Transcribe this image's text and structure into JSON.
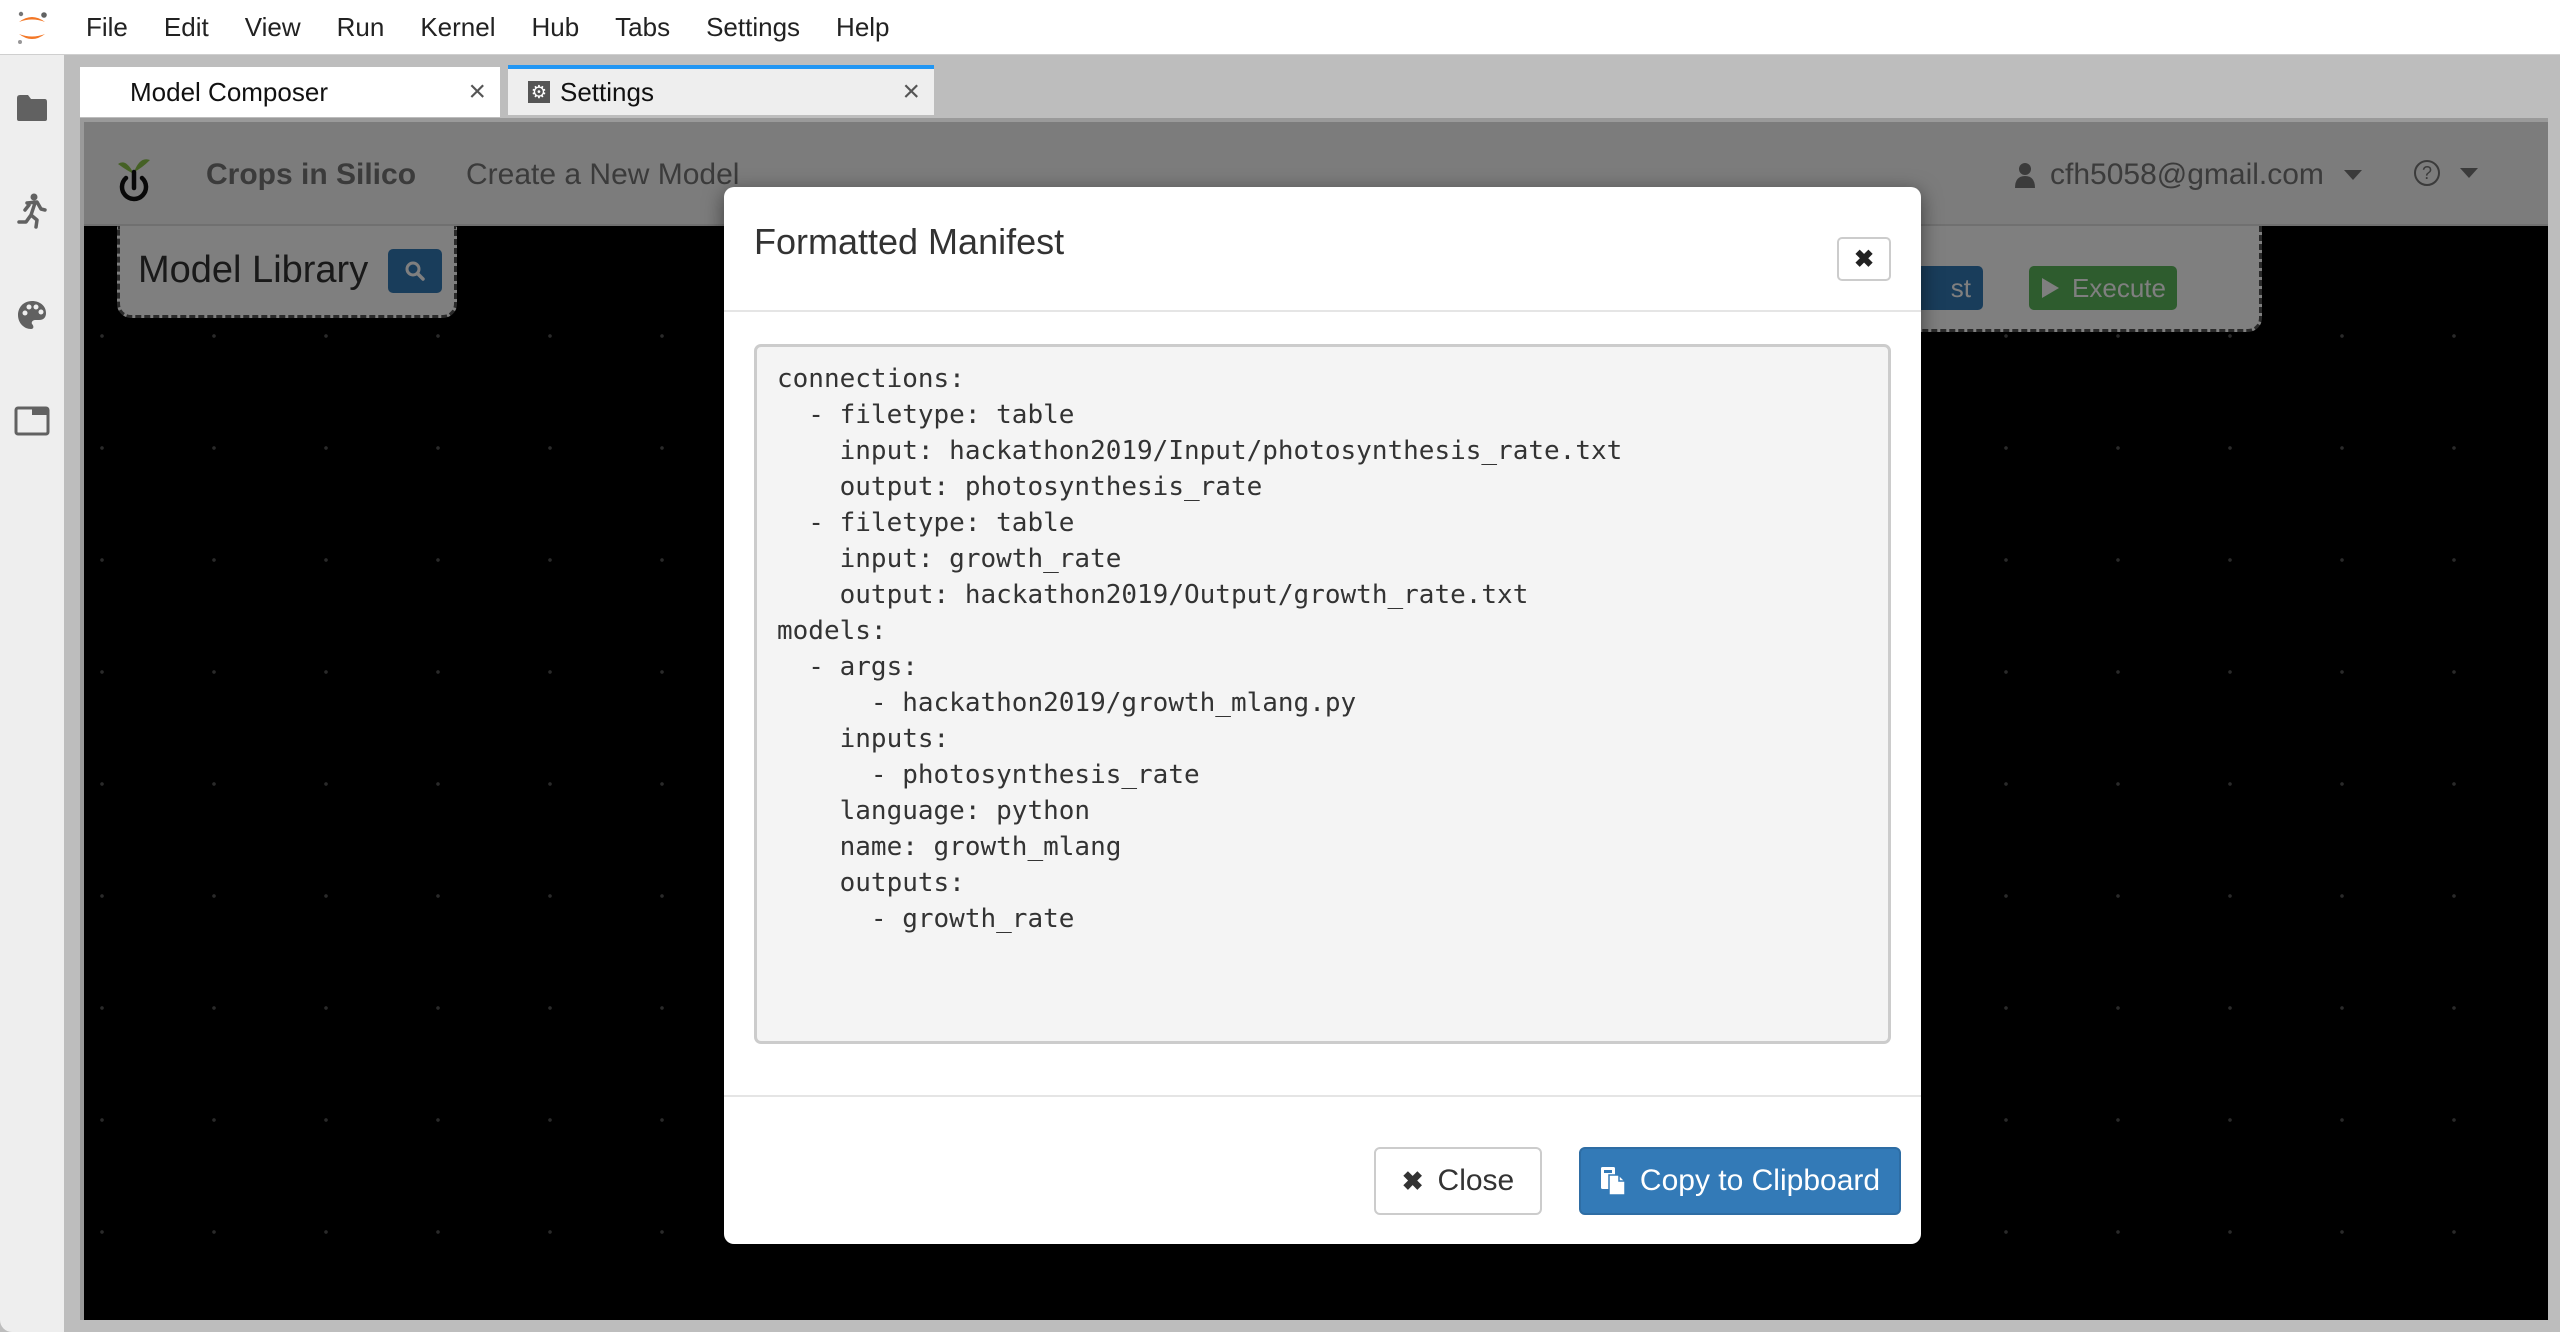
{
  "menubar": {
    "items": [
      "File",
      "Edit",
      "View",
      "Run",
      "Kernel",
      "Hub",
      "Tabs",
      "Settings",
      "Help"
    ]
  },
  "sidebar": {
    "icons": [
      "folder-icon",
      "running-icon",
      "palette-icon",
      "tabs-icon"
    ]
  },
  "tabs": [
    {
      "label": "Model Composer",
      "close": "×"
    },
    {
      "label": "Settings",
      "close": "×"
    }
  ],
  "app": {
    "brand": "Crops in Silico",
    "nav_link": "Create a New Model",
    "user": "cfh5058@gmail.com",
    "help_icon": "?",
    "library_title": "Model Library",
    "manifest_button_partial": "st",
    "execute_label": "Execute"
  },
  "modal": {
    "title": "Formatted Manifest",
    "close_x": "✖",
    "manifest": "connections:\n  - filetype: table\n    input: hackathon2019/Input/photosynthesis_rate.txt\n    output: photosynthesis_rate\n  - filetype: table\n    input: growth_rate\n    output: hackathon2019/Output/growth_rate.txt\nmodels:\n  - args:\n      - hackathon2019/growth_mlang.py\n    inputs:\n      - photosynthesis_rate\n    language: python\n    name: growth_mlang\n    outputs:\n      - growth_rate",
    "close_label": "Close",
    "copy_label": "Copy to Clipboard"
  },
  "colors": {
    "primary": "#337ab7",
    "success": "#5cb85c",
    "tab_accent": "#2196f3",
    "jupyter_orange": "#f37726"
  }
}
